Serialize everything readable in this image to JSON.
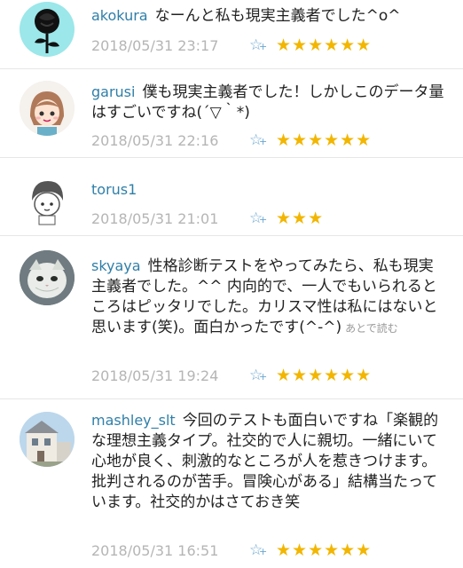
{
  "comments": [
    {
      "user": "akokura",
      "text": "なーんと私も現実主義者でした^o^",
      "date": "2018/05/31 23:17",
      "stars": 6,
      "later_label": "",
      "avatar": "black-rose"
    },
    {
      "user": "garusi",
      "text": "僕も現実主義者でした！しかしこのデータ量はすごいですね(´▽｀*)",
      "date": "2018/05/31 22:16",
      "stars": 6,
      "later_label": "",
      "avatar": "cartoon-girl"
    },
    {
      "user": "torus1",
      "text": "",
      "date": "2018/05/31 21:01",
      "stars": 3,
      "later_label": "",
      "avatar": "cartoon-boy"
    },
    {
      "user": "skyaya",
      "text": "性格診断テストをやってみたら、私も現実主義者でした。^^ 内向的で、一人でもいられるところはピッタリでした。カリスマ性は私にはないと思います(笑)。面白かったです(^-^)",
      "date": "2018/05/31 19:24",
      "stars": 6,
      "later_label": "あとで読む",
      "avatar": "cat"
    },
    {
      "user": "mashley_slt",
      "text": "今回のテストも面白いですね「楽観的な理想主義タイプ。社交的で人に親切。一緒にいて心地が良く、刺激的なところが人を惹きつけます。批判されるのが苦手。冒険心がある」結構当たっています。社交的かはさておき笑",
      "date": "2018/05/31 16:51",
      "stars": 6,
      "later_label": "",
      "avatar": "house-photo"
    }
  ],
  "icons": {
    "add_star": "star-add-icon",
    "star_glyph": "★",
    "add_star_glyph": "☆",
    "plus_glyph": "+"
  },
  "colors": {
    "username": "#2f7fa8",
    "star": "#f2b600",
    "date": "#b5b5b5"
  }
}
